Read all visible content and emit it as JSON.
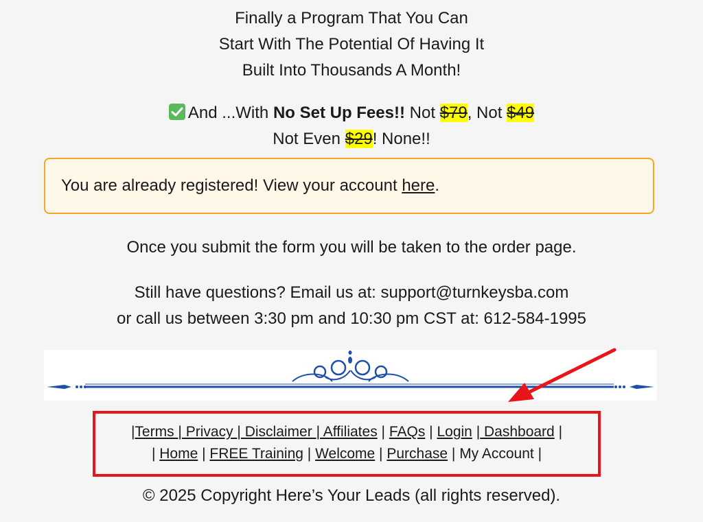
{
  "headline": {
    "line1": "Finally a Program That You Can",
    "line2": "Start With The Potential Of Having It",
    "line3": "Built Into Thousands A Month!"
  },
  "offer": {
    "prefix": "And ...With ",
    "bold": "No Set Up Fees!!",
    "not1": " Not ",
    "price1": "$79",
    "not2": ", Not ",
    "price2": "$49",
    "line2_prefix": "Not Even ",
    "price3": "$29",
    "line2_suffix": "! None!!"
  },
  "notice": {
    "text": "You are already registered! View your account ",
    "link": "here",
    "end": "."
  },
  "submit_note": "Once you submit the form you will be taken to the order page.",
  "contact": {
    "line1": "Still have questions? Email us at: support@turnkeysba.com",
    "line2": "or call us between 3:30 pm and 10:30 pm CST at: 612-584-1995"
  },
  "footer_nav": {
    "row1": [
      "Terms ",
      " Privacy ",
      " Disclaimer ",
      " Affiliates",
      "FAQs",
      "Login",
      " Dashboard"
    ],
    "row2": [
      "Home",
      "FREE Training",
      "Welcome",
      "Purchase"
    ],
    "my_account": "My Account"
  },
  "copyright": "© 2025 Copyright Here’s Your Leads (all rights reserved).",
  "colors": {
    "highlight": "#ffff00",
    "notice_border": "#f5a623",
    "annotation_red": "#e8151b",
    "divider_blue": "#1e4fa8"
  }
}
